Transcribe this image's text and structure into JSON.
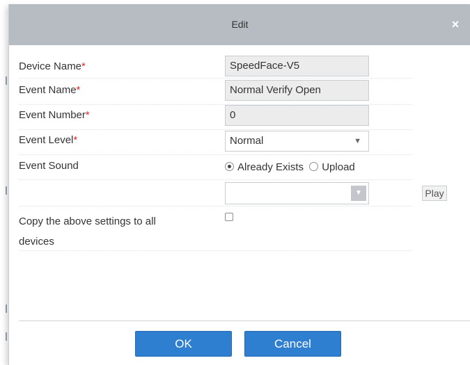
{
  "dialog": {
    "title": "Edit",
    "close_glyph": "×"
  },
  "form": {
    "device_name": {
      "label": "Device Name",
      "required_mark": "*",
      "value": "SpeedFace-V5"
    },
    "event_name": {
      "label": "Event Name",
      "required_mark": "*",
      "value": "Normal Verify Open"
    },
    "event_number": {
      "label": "Event Number",
      "required_mark": "*",
      "value": "0"
    },
    "event_level": {
      "label": "Event Level",
      "required_mark": "*",
      "value": "Normal",
      "arrow": "▼"
    },
    "event_sound": {
      "label": "Event Sound",
      "options": [
        "Already Exists",
        "Upload"
      ],
      "selected": "Already Exists",
      "select_value": "",
      "arrow": "▼",
      "play_label": "Play"
    },
    "copy_settings": {
      "label_line1": "Copy the above settings to all",
      "label_line2": "devices",
      "checked": false
    }
  },
  "buttons": {
    "ok_label": "OK",
    "cancel_label": "Cancel"
  },
  "colors": {
    "title_bar": "#b7bcc2",
    "primary_button": "#2f7fd1",
    "required": "#e02a2a"
  }
}
